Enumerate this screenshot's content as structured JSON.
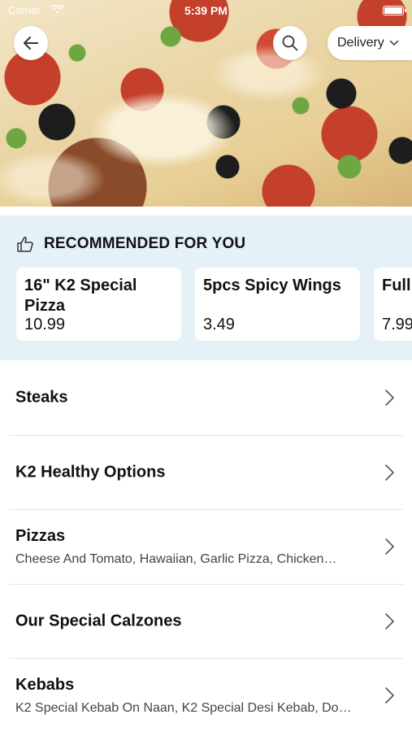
{
  "status_bar": {
    "carrier": "Carrier",
    "time": "5:39 PM"
  },
  "header": {
    "back_icon": "arrow-left-icon",
    "search_icon": "search-icon",
    "delivery_label": "Delivery"
  },
  "recommended": {
    "title": "RECOMMENDED FOR YOU",
    "icon": "thumbs-up-icon",
    "items": [
      {
        "name": "16\" K2 Special Pizza",
        "price": "10.99"
      },
      {
        "name": "5pcs Spicy Wings",
        "price": "3.49"
      },
      {
        "name": "Full I",
        "price": "7.99"
      }
    ]
  },
  "menu": {
    "categories": [
      {
        "title": "Steaks",
        "subtitle": ""
      },
      {
        "title": "K2 Healthy Options",
        "subtitle": ""
      },
      {
        "title": "Pizzas",
        "subtitle": "Cheese And Tomato, Hawaiian, Garlic Pizza, Chicken…"
      },
      {
        "title": "Our Special Calzones",
        "subtitle": ""
      },
      {
        "title": "Kebabs",
        "subtitle": "K2 Special Kebab On Naan, K2 Special Desi Kebab, Do…"
      }
    ]
  },
  "colors": {
    "recommended_bg": "#e4f1f6",
    "divider": "#e6e6e6"
  }
}
